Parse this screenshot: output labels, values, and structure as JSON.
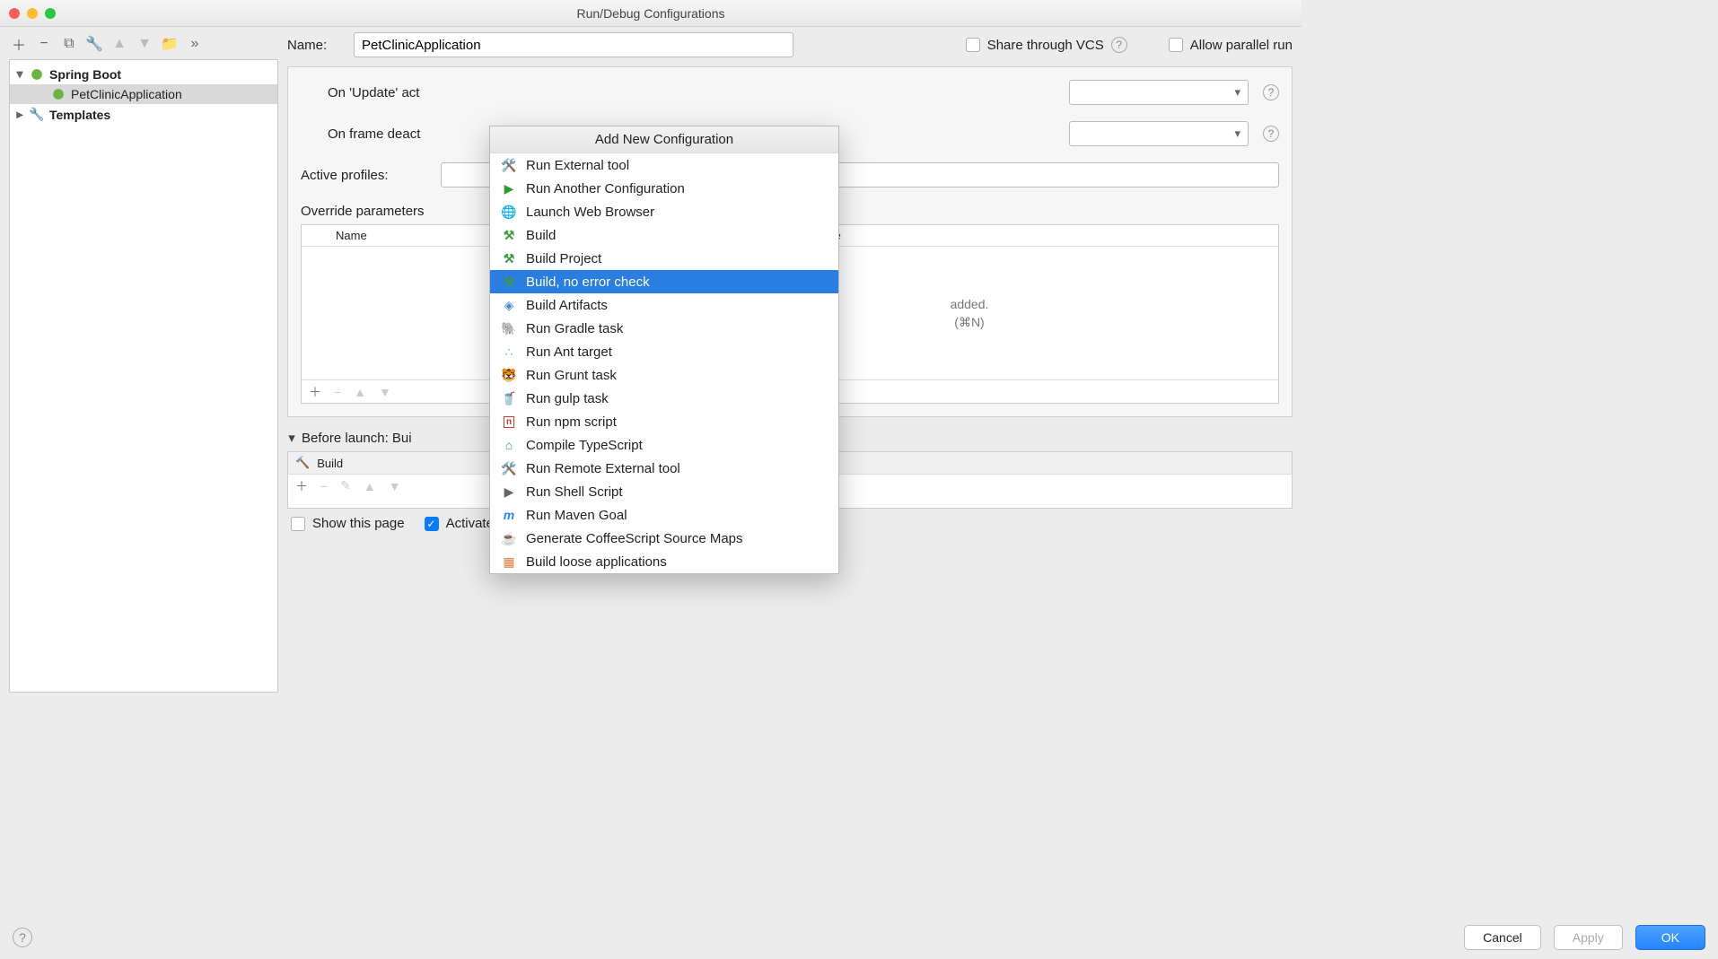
{
  "window": {
    "title": "Run/Debug Configurations"
  },
  "sidebar": {
    "nodes": {
      "spring_boot": "Spring Boot",
      "petclinic": "PetClinicApplication",
      "templates": "Templates"
    }
  },
  "form": {
    "name_label": "Name:",
    "name_value": "PetClinicApplication",
    "share_label": "Share through VCS",
    "allow_parallel_label": "Allow parallel run",
    "on_update_label": "On 'Update' act",
    "on_frame_label": "On frame deact",
    "active_profiles_label": "Active profiles:",
    "override_label": "Override parameters",
    "table": {
      "col_name": "Name",
      "col_value": "Value",
      "empty1": "added.",
      "empty2": "(⌘N)"
    },
    "before_header": "Before launch: Bui",
    "before_item": "Build",
    "show_page": "Show this page",
    "activate_tool": "Activate tool window"
  },
  "popup": {
    "title": "Add New Configuration",
    "items": [
      {
        "icon": "wrench-cross",
        "label": "Run External tool"
      },
      {
        "icon": "play-green",
        "label": "Run Another Configuration"
      },
      {
        "icon": "globe",
        "label": "Launch Web Browser"
      },
      {
        "icon": "hammer-green",
        "label": "Build"
      },
      {
        "icon": "hammer-green",
        "label": "Build Project"
      },
      {
        "icon": "hammer-green",
        "label": "Build, no error check",
        "selected": true
      },
      {
        "icon": "diamond-blue",
        "label": "Build Artifacts"
      },
      {
        "icon": "elephant",
        "label": "Run Gradle task"
      },
      {
        "icon": "ant",
        "label": "Run Ant target"
      },
      {
        "icon": "tiger",
        "label": "Run Grunt task"
      },
      {
        "icon": "gulp",
        "label": "Run gulp task"
      },
      {
        "icon": "npm",
        "label": "Run npm script"
      },
      {
        "icon": "ts",
        "label": "Compile TypeScript"
      },
      {
        "icon": "wrench-cross",
        "label": "Run Remote External tool"
      },
      {
        "icon": "shell",
        "label": "Run Shell Script"
      },
      {
        "icon": "maven",
        "label": "Run Maven Goal"
      },
      {
        "icon": "coffee",
        "label": "Generate CoffeeScript Source Maps"
      },
      {
        "icon": "app",
        "label": "Build loose applications"
      }
    ]
  },
  "footer": {
    "cancel": "Cancel",
    "apply": "Apply",
    "ok": "OK"
  }
}
